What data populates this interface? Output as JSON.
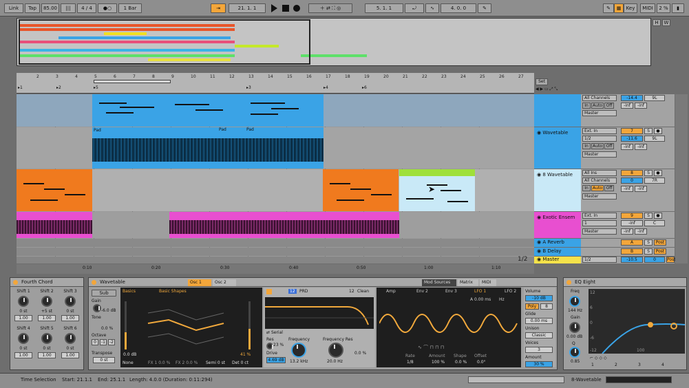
{
  "transport": {
    "link": "Link",
    "tap": "Tap",
    "tempo": "85.00",
    "meter": "4 / 4",
    "quantize": "1 Bar",
    "position": "21.  1.  1",
    "loop_start": "5.  1.  1",
    "loop_length": "4.  0.  0",
    "key": "Key",
    "midi": "MIDI",
    "cpu": "2 %",
    "h_label": "H",
    "w_label": "W"
  },
  "ruler": {
    "bars": [
      "2",
      "3",
      "4",
      "5",
      "6",
      "7",
      "8",
      "9",
      "10",
      "11",
      "12",
      "13",
      "14",
      "15",
      "16",
      "17",
      "18",
      "19",
      "20",
      "21",
      "22",
      "23",
      "24",
      "25",
      "26",
      "27"
    ],
    "locators": [
      "1",
      "2",
      "5",
      "3",
      "4",
      "6"
    ],
    "times": [
      "0:10",
      "0:20",
      "0:30",
      "0:40",
      "0:50",
      "1:00",
      "1:10"
    ],
    "set_label": "Set",
    "zoom_ratio": "1/2"
  },
  "tracks": [
    {
      "name": "",
      "input": "All Channels",
      "monitor": [
        "In",
        "Auto",
        "Off"
      ],
      "output": "Master",
      "volume": "-14.4",
      "pan": "9L",
      "send_a": "-inf",
      "send_b": "-inf"
    },
    {
      "name": "Wavetable",
      "input": "Ext. In",
      "input_ch": "1/2",
      "monitor": [
        "In",
        "Auto",
        "Off"
      ],
      "output": "Master",
      "number": "7",
      "volume": "-11.6",
      "pan": "9L",
      "send_a": "-inf",
      "send_b": "-inf",
      "clip_label": "Pad"
    },
    {
      "name": "8 Wavetable",
      "input": "All Ins",
      "input_ch": "All Channels",
      "monitor": [
        "In",
        "Auto",
        "Off"
      ],
      "output": "Master",
      "number": "8",
      "volume": "0",
      "pan": "7R",
      "send_a": "-inf",
      "send_b": "-inf"
    },
    {
      "name": "Exotic Ensem",
      "input": "Ext. In",
      "input_ch": "1",
      "output": "Master",
      "number": "9",
      "volume": "-inf",
      "pan": "C",
      "send_a": "-inf",
      "send_b": "-inf"
    },
    {
      "name": "A Reverb",
      "letter": "A",
      "post": "Post"
    },
    {
      "name": "B Delay",
      "letter": "B",
      "post": "Post"
    },
    {
      "name": "Master",
      "output": "1/2",
      "volume": "-10.5",
      "pan": "0",
      "post": "Post"
    }
  ],
  "devices": {
    "chord": {
      "title": "Fourth Chord",
      "knobs": [
        {
          "label": "Shift 1",
          "value": "0 st",
          "vel": "1.00"
        },
        {
          "label": "Shift 2",
          "value": "+5 st",
          "vel": "1.00"
        },
        {
          "label": "Shift 3",
          "value": "0 st",
          "vel": "1.00"
        },
        {
          "label": "Shift 4",
          "value": "0 st",
          "vel": "1.00"
        },
        {
          "label": "Shift 5",
          "value": "0 st",
          "vel": "1.00"
        },
        {
          "label": "Shift 6",
          "value": "0 st",
          "vel": "1.00"
        }
      ]
    },
    "wavetable": {
      "title": "Wavetable",
      "sub": "Sub",
      "gain_label": "Gain",
      "gain_value": "-6.0 dB",
      "tone_label": "Tone",
      "tone_value": "0.0 %",
      "octave_label": "Octave",
      "octave_values": [
        "0",
        "-1",
        "-2"
      ],
      "transpose_label": "Transpose",
      "transpose_value": "0 st",
      "osc_tabs": [
        "Osc 1",
        "Osc 2"
      ],
      "category": "Basics",
      "wavetable_name": "Basic Shapes",
      "osc_gain": "0.0 dB",
      "osc_pos": "41 %",
      "fx_mode": "None",
      "fx1": "FX 1 0.0 %",
      "fx2": "FX 2 0.0 %",
      "semi": "Semi 0 st",
      "det": "Det 0 ct",
      "filter_num": "12",
      "filter_type": "PRD",
      "filter2_num": "12",
      "filter2_type": "Clean",
      "routing": "Serial",
      "res_label": "Res",
      "res_value": "23 %",
      "freq_label": "Frequency",
      "freq_value": "13.2 kHz",
      "drive_label": "Drive",
      "drive_value": "4.69 dB",
      "freq_res_label": "Frequency Res",
      "freq2_value": "20.0 Hz",
      "res2_value": "0.0 %",
      "mod_tabs": [
        "Mod Sources",
        "Matrix",
        "MIDI"
      ],
      "env_tabs": [
        "Amp",
        "Env 2",
        "Env 3",
        "LFO 1",
        "LFO 2"
      ],
      "lfo_time": "0.00 ms",
      "lfo_hz": "Hz",
      "lfo_rate_label": "Rate",
      "lfo_rate": "1/8",
      "lfo_amount_label": "Amount",
      "lfo_amount": "100 %",
      "lfo_shape_label": "Shape",
      "lfo_shape": "0.0 %",
      "lfo_offset_label": "Offset",
      "lfo_offset": "0.0°",
      "volume_label": "Volume",
      "volume_value": "-10 dB",
      "poly": "Poly",
      "voices_count": "8",
      "glide_label": "Glide",
      "glide_value": "0.00 ms",
      "unison_label": "Unison",
      "unison_value": "Classic",
      "voices_label": "Voices",
      "voices_value": "3",
      "amount_label": "Amount",
      "amount_value": "30 %"
    },
    "eq": {
      "title": "EQ Eight",
      "freq_label": "Freq",
      "freq_value": "144 Hz",
      "gain_label": "Gain",
      "gain_value": "0.00 dB",
      "q_label": "Q",
      "q_value": "0.85",
      "db_ticks": [
        "12",
        "6",
        "0",
        "-6",
        "-12"
      ],
      "freq_tick": "100",
      "bands": [
        "1",
        "2",
        "3",
        "4"
      ]
    }
  },
  "status": {
    "mode": "Time Selection",
    "start": "Start: 21.1.1",
    "end": "End: 25.1.1",
    "length": "Length: 4.0.0 (Duration: 0:11:294)",
    "track": "8-Wavetable"
  },
  "colors": {
    "blue": "#3aa3e6",
    "orange": "#f07a1e",
    "magenta": "#e84fd0",
    "lightblue": "#c9e9f7",
    "lime": "#9fe03a",
    "yellow": "#f5d64a",
    "lfo": "#f0a83c"
  }
}
